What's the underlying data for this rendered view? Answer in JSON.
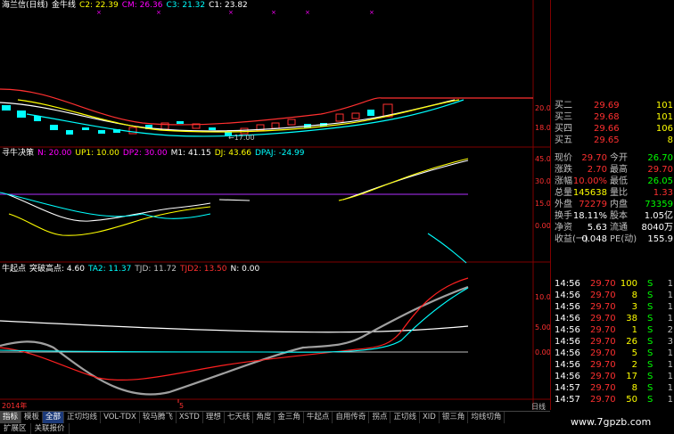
{
  "pane1": {
    "stock_name": "海兰信(日线)",
    "indicator": "金牛线",
    "items": [
      {
        "label": "C2: 22.39",
        "color": "#ffff00"
      },
      {
        "label": "CM: 26.36",
        "color": "#ff00ff"
      },
      {
        "label": "C3: 21.32",
        "color": "#00ffff"
      },
      {
        "label": "C1: 23.82",
        "color": "#ffffff"
      }
    ],
    "y_ticks": [
      "20.00",
      "18.00"
    ],
    "low_mark": "←17.00"
  },
  "pane2": {
    "indicator": "寻牛决策",
    "items": [
      {
        "label": "N: 20.00",
        "color": "#ff00ff"
      },
      {
        "label": "UP1: 10.00",
        "color": "#ffff00"
      },
      {
        "label": "DP2: 30.00",
        "color": "#ff00ff"
      },
      {
        "label": "M1: 41.15",
        "color": "#ffffff"
      },
      {
        "label": "DJ: 43.66",
        "color": "#ffff00"
      },
      {
        "label": "DPAJ: -24.99",
        "color": "#00ffff"
      }
    ],
    "y_ticks": [
      "45.00",
      "30.00",
      "15.00",
      "0.00"
    ]
  },
  "pane3": {
    "indicator": "牛起点",
    "items": [
      {
        "label": "突破高点: 4.60",
        "color": "#ffffff"
      },
      {
        "label": "TA2: 11.37",
        "color": "#00ffff"
      },
      {
        "label": "TJD: 11.72",
        "color": "#c0c0c0"
      },
      {
        "label": "TJD2: 13.50",
        "color": "#ff0000"
      },
      {
        "label": "N: 0.00",
        "color": "#ffffff"
      }
    ],
    "y_ticks": [
      "10.00",
      "5.00",
      "0.00"
    ]
  },
  "x_axis": {
    "year": "2014年",
    "month": "5"
  },
  "order_book": [
    {
      "label": "买二",
      "price": "29.69",
      "vol": "101"
    },
    {
      "label": "买三",
      "price": "29.68",
      "vol": "101"
    },
    {
      "label": "买四",
      "price": "29.66",
      "vol": "106"
    },
    {
      "label": "买五",
      "price": "29.65",
      "vol": "8"
    }
  ],
  "quote": [
    {
      "l1": "现价",
      "v1": "29.70",
      "c1": "#ff3030",
      "l2": "今开",
      "v2": "26.70",
      "c2": "#00ff00"
    },
    {
      "l1": "涨跌",
      "v1": "2.70",
      "c1": "#ff3030",
      "l2": "最高",
      "v2": "29.70",
      "c2": "#ff3030"
    },
    {
      "l1": "涨幅",
      "v1": "10.00%",
      "c1": "#ff3030",
      "l2": "最低",
      "v2": "26.05",
      "c2": "#00ff00"
    },
    {
      "l1": "总量",
      "v1": "145638",
      "c1": "#ffff00",
      "l2": "量比",
      "v2": "1.33",
      "c2": "#ff3030"
    },
    {
      "l1": "外盘",
      "v1": "72279",
      "c1": "#ff3030",
      "l2": "内盘",
      "v2": "73359",
      "c2": "#00ff00"
    },
    {
      "l1": "换手",
      "v1": "18.11%",
      "c1": "#ffffff",
      "l2": "股本",
      "v2": "1.05亿",
      "c2": "#ffffff"
    },
    {
      "l1": "净资",
      "v1": "5.63",
      "c1": "#ffffff",
      "l2": "流通",
      "v2": "8040万",
      "c2": "#ffffff"
    },
    {
      "l1": "收益(一)",
      "v1": "0.048",
      "c1": "#ffffff",
      "l2": "PE(动)",
      "v2": "155.9",
      "c2": "#ffffff"
    }
  ],
  "trades": [
    {
      "time": "14:56",
      "price": "29.70",
      "vol": "100",
      "bs": "S",
      "n": "1"
    },
    {
      "time": "14:56",
      "price": "29.70",
      "vol": "8",
      "bs": "S",
      "n": "1"
    },
    {
      "time": "14:56",
      "price": "29.70",
      "vol": "3",
      "bs": "S",
      "n": "1"
    },
    {
      "time": "14:56",
      "price": "29.70",
      "vol": "38",
      "bs": "S",
      "n": "1"
    },
    {
      "time": "14:56",
      "price": "29.70",
      "vol": "1",
      "bs": "S",
      "n": "2"
    },
    {
      "time": "14:56",
      "price": "29.70",
      "vol": "26",
      "bs": "S",
      "n": "3"
    },
    {
      "time": "14:56",
      "price": "29.70",
      "vol": "5",
      "bs": "S",
      "n": "1"
    },
    {
      "time": "14:56",
      "price": "29.70",
      "vol": "2",
      "bs": "S",
      "n": "1"
    },
    {
      "time": "14:56",
      "price": "29.70",
      "vol": "17",
      "bs": "S",
      "n": "1"
    },
    {
      "time": "14:57",
      "price": "29.70",
      "vol": "8",
      "bs": "S",
      "n": "1"
    },
    {
      "time": "14:57",
      "price": "29.70",
      "vol": "50",
      "bs": "S",
      "n": "1"
    }
  ],
  "tabs": [
    "指标",
    "模板",
    "全部",
    "正切均线",
    "VOL-TDX",
    "较马腾飞",
    "XSTD",
    "理想",
    "七天线",
    "角度",
    "金三角",
    "牛起点",
    "自用传奇",
    "拐点",
    "正切线",
    "XID",
    "银三角",
    "均线切角"
  ],
  "active_tab": "全部",
  "bottom_tabs": [
    "扩展区",
    "关联报价"
  ],
  "scroll_label": "日线",
  "watermark": "www.7gpzb.com",
  "colors": {
    "up": "#ff3030",
    "down": "#00ffff",
    "ma_white": "#ffffff",
    "ma_yellow": "#ffff00",
    "frame": "#800000"
  }
}
